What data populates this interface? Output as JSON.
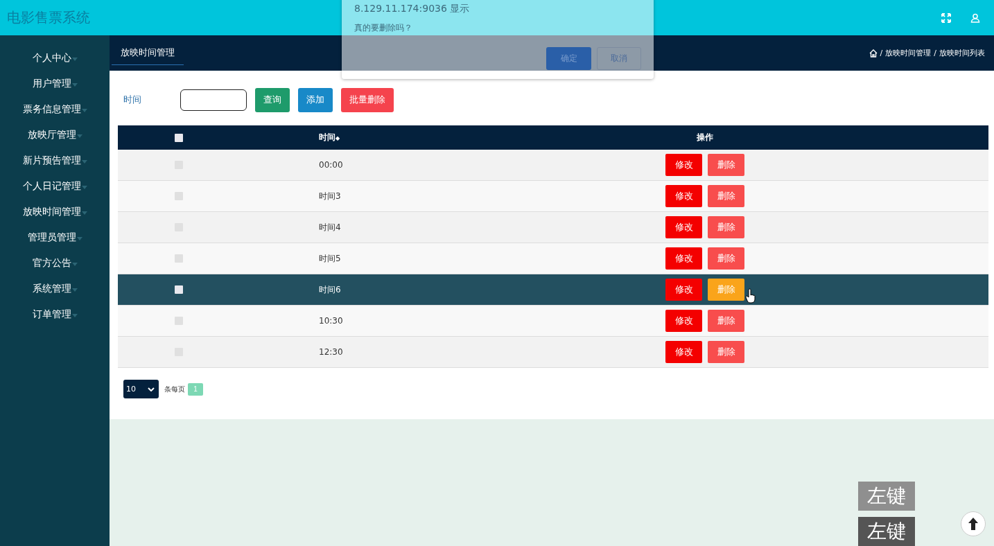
{
  "header": {
    "title": "电影售票系统"
  },
  "sidebar": {
    "items": [
      {
        "label": "个人中心"
      },
      {
        "label": "用户管理"
      },
      {
        "label": "票务信息管理"
      },
      {
        "label": "放映厅管理"
      },
      {
        "label": "新片预告管理"
      },
      {
        "label": "个人日记管理"
      },
      {
        "label": "放映时间管理"
      },
      {
        "label": "管理员管理"
      },
      {
        "label": "官方公告"
      },
      {
        "label": "系统管理"
      },
      {
        "label": "订单管理"
      }
    ]
  },
  "tabs": [
    {
      "label": "放映时间管理",
      "selected": true
    }
  ],
  "breadcrumb": [
    {
      "sep": "/",
      "label": "放映时间管理"
    },
    {
      "sep": "/",
      "label": "放映时间列表"
    }
  ],
  "search": {
    "label": "时间",
    "buttons": [
      {
        "label": "查询",
        "kind": "search"
      },
      {
        "label": "添加",
        "kind": "add"
      },
      {
        "label": "批量删除",
        "kind": "delete"
      }
    ]
  },
  "table": {
    "select_all": {
      "checked": false
    },
    "columns": [
      "时间",
      "操作"
    ],
    "header_sort": "◆",
    "rows": [
      {
        "time": "00:00",
        "hovered": false,
        "edit": "修改",
        "delete": "删除"
      },
      {
        "time": "时间3",
        "hovered": false,
        "edit": "修改",
        "delete": "删除"
      },
      {
        "time": "时间4",
        "hovered": false,
        "edit": "修改",
        "delete": "删除"
      },
      {
        "time": "时间5",
        "hovered": false,
        "edit": "修改",
        "delete": "删除"
      },
      {
        "time": "时间6",
        "hovered": true,
        "edit": "修改",
        "delete": "删除"
      },
      {
        "time": "10:30",
        "hovered": false,
        "edit": "修改",
        "delete": "删除"
      },
      {
        "time": "12:30",
        "hovered": false,
        "edit": "修改",
        "delete": "删除"
      }
    ]
  },
  "pagination": {
    "page_size": "10",
    "per_page_label": "条每页",
    "pages": [
      {
        "label": "1",
        "selected": true
      }
    ]
  },
  "dialog": {
    "origin": "8.129.11.174:9036 显示",
    "message": "真的要删除吗？",
    "ok": "确定",
    "cancel": "取消"
  },
  "key_overlays": [
    "左键",
    "左键"
  ]
}
